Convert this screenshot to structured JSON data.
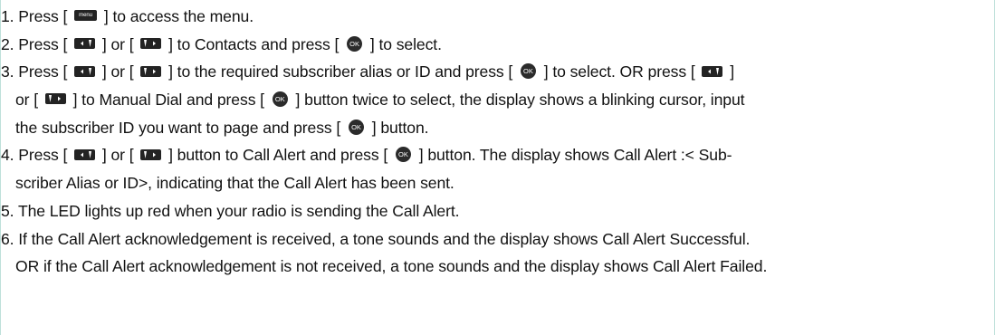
{
  "icons": {
    "menu_button": {
      "name": "menu-button-icon",
      "label": "menu"
    },
    "up_button": {
      "name": "up-arrow-button-icon"
    },
    "down_button": {
      "name": "down-arrow-button-icon"
    },
    "ok_button": {
      "name": "ok-button-icon",
      "label": "OK"
    }
  },
  "steps": {
    "s1": {
      "a": "1. Press [ ",
      "b": " ] to access the menu."
    },
    "s2": {
      "a": "2. Press [ ",
      "b": " ] or [ ",
      "c": " ] to Contacts and press [ ",
      "d": " ] to select."
    },
    "s3": {
      "a": "3. Press [ ",
      "b": " ] or [ ",
      "c": " ] to the required subscriber alias or ID and press [ ",
      "d": " ] to select. OR press [ ",
      "e": " ]",
      "f": "or [ ",
      "g": " ] to Manual Dial and press [ ",
      "h": " ] button twice to select, the display shows a blinking cursor, input",
      "i": "the subscriber ID you want to page and press [ ",
      "j": " ] button."
    },
    "s4": {
      "a": "4. Press [ ",
      "b": " ] or [ ",
      "c": " ] button to Call Alert and press [ ",
      "d": " ] button. The display shows Call Alert :< Sub-",
      "e": "scriber Alias or ID>, indicating that the Call Alert has been sent."
    },
    "s5": {
      "a": "5. The LED lights up red when your radio is sending the Call Alert."
    },
    "s6": {
      "a": "6. If the Call Alert acknowledgement is received, a tone sounds and the display shows Call Alert Successful.",
      "b": "OR if the Call Alert acknowledgement is not received, a tone sounds and the display shows Call Alert Failed."
    }
  }
}
